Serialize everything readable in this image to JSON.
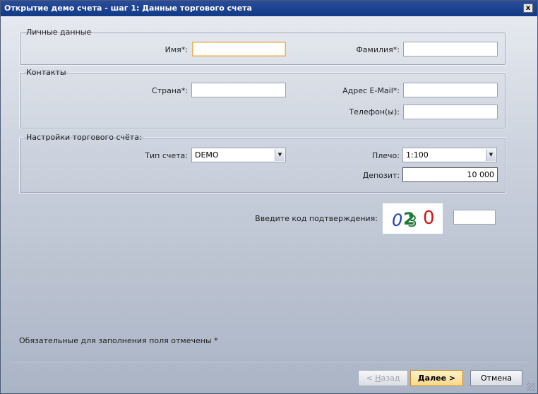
{
  "window": {
    "title": "Открытие демо счета - шаг 1: Данные торгового счета",
    "close_label": "x"
  },
  "personal": {
    "legend": "Личные данные",
    "first_name_label": "Имя*:",
    "first_name_value": "",
    "last_name_label": "Фамилия*:",
    "last_name_value": ""
  },
  "contacts": {
    "legend": "Контакты",
    "country_label": "Страна*:",
    "country_value": "",
    "email_label": "Адрес E-Mail*:",
    "email_value": "",
    "phone_label": "Телефон(ы):",
    "phone_value": ""
  },
  "trading": {
    "legend": "Настройки торгового счёта:",
    "account_type_label": "Тип счета:",
    "account_type_value": "DEMO",
    "leverage_label": "Плечо:",
    "leverage_value": "1:100",
    "deposit_label": "Депозит:",
    "deposit_value": "10 000"
  },
  "captcha": {
    "label": "Введите код подтверждения:",
    "chars": [
      "0",
      "2",
      "3",
      "0"
    ],
    "colors": [
      "#1f3fc8",
      "#1f7a3a",
      "#1f7a3a",
      "#d01818"
    ],
    "input_value": ""
  },
  "footer": {
    "required_note": "Обязательные для заполнения поля отмечены *"
  },
  "buttons": {
    "back_prefix": "< ",
    "back_underlined": "Н",
    "back_rest": "азад",
    "next_underlined": "Д",
    "next_rest": "алее >",
    "cancel": "Отмена"
  }
}
